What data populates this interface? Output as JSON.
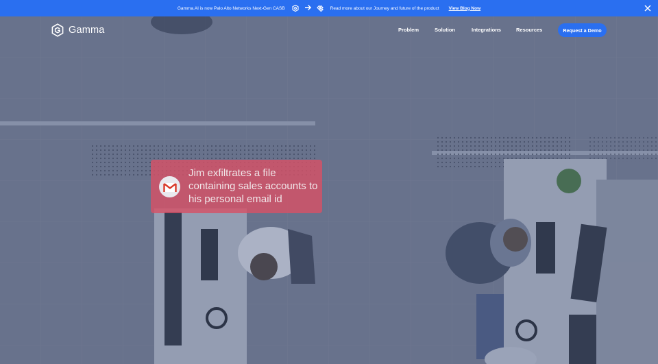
{
  "announcement": {
    "text": "Gamma.AI is now Palo Alto Networks Next-Gen CASB",
    "text2": "Read more about our Journey and future of the product",
    "link": "View Blog Now",
    "icons": [
      "gamma-logo-icon",
      "arrow-right-icon",
      "palo-alto-logo-icon",
      "close-icon"
    ]
  },
  "nav": {
    "brand": "Gamma",
    "links": [
      "Problem",
      "Solution",
      "Integrations",
      "Resources"
    ],
    "cta": "Request a Demo"
  },
  "hero": {
    "notification": {
      "icon": "gmail-icon",
      "message": "Jim exfiltrates a file containing sales accounts to his personal email id"
    }
  },
  "colors": {
    "accent": "#2a6ff0",
    "notification_bg": "#d65266"
  }
}
